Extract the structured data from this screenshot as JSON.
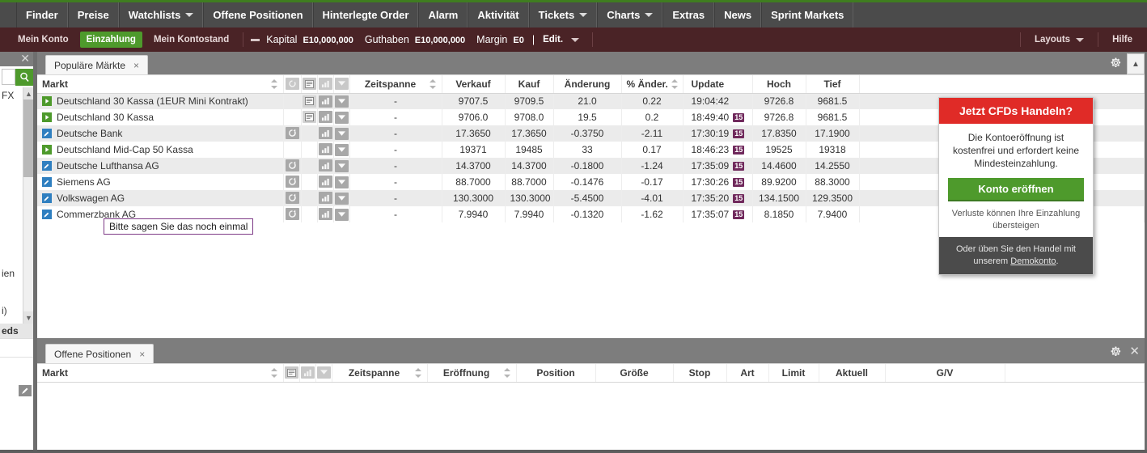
{
  "topnav": {
    "items": [
      {
        "label": "Finder",
        "caret": false
      },
      {
        "label": "Preise",
        "caret": false
      },
      {
        "label": "Watchlists",
        "caret": true
      },
      {
        "label": "Offene Positionen",
        "caret": false
      },
      {
        "label": "Hinterlegte Order",
        "caret": false
      },
      {
        "label": "Alarm",
        "caret": false
      },
      {
        "label": "Aktivität",
        "caret": false
      },
      {
        "label": "Tickets",
        "caret": true
      },
      {
        "label": "Charts",
        "caret": true
      },
      {
        "label": "Extras",
        "caret": false
      },
      {
        "label": "News",
        "caret": false
      },
      {
        "label": "Sprint Markets",
        "caret": false
      }
    ]
  },
  "accountbar": {
    "mein_konto": "Mein Konto",
    "einzahlung": "Einzahlung",
    "mein_kontostand": "Mein Kontostand",
    "kapital_label": "Kapital",
    "kapital_value": "E10,000,000",
    "guthaben_label": "Guthaben",
    "guthaben_value": "E10,000,000",
    "margin_label": "Margin",
    "margin_value": "E0",
    "divider": "|",
    "edit": "Edit.",
    "layouts": "Layouts",
    "hilfe": "Hilfe",
    "accent_green": "#4e9a2c",
    "bar_color": "#4a2326"
  },
  "leftpanel": {
    "close_icon": "close-icon",
    "search_icon": "search-icon",
    "rows": [
      "FX",
      "",
      "",
      "",
      "",
      "ien",
      "",
      "i)",
      ""
    ],
    "footer_row": "eds",
    "scroll_up": "▲",
    "scroll_down": "▼"
  },
  "popular_panel": {
    "tab_label": "Populäre Märkte",
    "tab_close": "×",
    "gear_icon": "gear-icon",
    "close_icon": "close-icon",
    "columns": [
      {
        "key": "markt",
        "label": "Markt",
        "align": "left",
        "sorter": true
      },
      {
        "key": "ico1",
        "label": "",
        "align": "center",
        "sorter": false
      },
      {
        "key": "ico2",
        "label": "",
        "align": "center",
        "sorter": false
      },
      {
        "key": "ico3",
        "label": "",
        "align": "center",
        "sorter": false
      },
      {
        "key": "ico4",
        "label": "",
        "align": "center",
        "sorter": false
      },
      {
        "key": "zeitspanne",
        "label": "Zeitspanne",
        "align": "center",
        "sorter": true
      },
      {
        "key": "verkauf",
        "label": "Verkauf",
        "align": "center",
        "sorter": false
      },
      {
        "key": "kauf",
        "label": "Kauf",
        "align": "center",
        "sorter": false
      },
      {
        "key": "aenderung",
        "label": "Änderung",
        "align": "center",
        "sorter": false
      },
      {
        "key": "pct",
        "label": "% Änder.",
        "align": "center",
        "sorter": true
      },
      {
        "key": "update",
        "label": "Update",
        "align": "center",
        "sorter": false
      },
      {
        "key": "hoch",
        "label": "Hoch",
        "align": "center",
        "sorter": false
      },
      {
        "key": "tief",
        "label": "Tief",
        "align": "center",
        "sorter": false
      },
      {
        "key": "blank",
        "label": "",
        "align": "center",
        "sorter": false
      }
    ],
    "header_icons": [
      "sort-icon",
      "refresh-icon",
      "news-icon",
      "chart-icon",
      "chevron-down-icon"
    ],
    "rows": [
      {
        "markt": "Deutschland 30 Kassa (1EUR Mini Kontrakt)",
        "marker": "green",
        "has_refresh": false,
        "has_news": true,
        "zeitspanne": "-",
        "verkauf": "9707.5",
        "kauf": "9709.5",
        "aenderung": "21.0",
        "aenderung_dir": "up",
        "pct": "0.22",
        "pct_dir": "up",
        "update": "19:04:42",
        "delay": "",
        "hoch": "9726.8",
        "tief": "9681.5"
      },
      {
        "markt": "Deutschland 30 Kassa",
        "marker": "green",
        "has_refresh": false,
        "has_news": true,
        "zeitspanne": "-",
        "verkauf": "9706.0",
        "kauf": "9708.0",
        "aenderung": "19.5",
        "aenderung_dir": "up",
        "pct": "0.2",
        "pct_dir": "up",
        "update": "18:49:40",
        "delay": "15",
        "hoch": "9726.8",
        "tief": "9681.5"
      },
      {
        "markt": "Deutsche Bank",
        "marker": "blue",
        "has_refresh": true,
        "has_news": false,
        "zeitspanne": "-",
        "verkauf": "17.3650",
        "kauf": "17.3650",
        "aenderung": "-0.3750",
        "aenderung_dir": "down",
        "pct": "-2.11",
        "pct_dir": "down",
        "update": "17:30:19",
        "delay": "15",
        "hoch": "17.8350",
        "tief": "17.1900"
      },
      {
        "markt": "Deutschland Mid-Cap 50 Kassa",
        "marker": "green",
        "has_refresh": false,
        "has_news": false,
        "zeitspanne": "-",
        "verkauf": "19371",
        "kauf": "19485",
        "aenderung": "33",
        "aenderung_dir": "up",
        "pct": "0.17",
        "pct_dir": "up",
        "update": "18:46:23",
        "delay": "15",
        "hoch": "19525",
        "tief": "19318"
      },
      {
        "markt": "Deutsche Lufthansa AG",
        "marker": "blue",
        "has_refresh": true,
        "has_news": false,
        "zeitspanne": "-",
        "verkauf": "14.3700",
        "kauf": "14.3700",
        "aenderung": "-0.1800",
        "aenderung_dir": "down",
        "pct": "-1.24",
        "pct_dir": "down",
        "update": "17:35:09",
        "delay": "15",
        "hoch": "14.4600",
        "tief": "14.2550"
      },
      {
        "markt": "Siemens AG",
        "marker": "blue",
        "has_refresh": true,
        "has_news": false,
        "zeitspanne": "-",
        "verkauf": "88.7000",
        "kauf": "88.7000",
        "aenderung": "-0.1476",
        "aenderung_dir": "down",
        "pct": "-0.17",
        "pct_dir": "down",
        "update": "17:30:26",
        "delay": "15",
        "hoch": "89.9200",
        "tief": "88.3000"
      },
      {
        "markt": "Volkswagen AG",
        "marker": "blue",
        "has_refresh": true,
        "has_news": false,
        "zeitspanne": "-",
        "verkauf": "130.3000",
        "kauf": "130.3000",
        "aenderung": "-5.4500",
        "aenderung_dir": "down",
        "pct": "-4.01",
        "pct_dir": "down",
        "update": "17:35:20",
        "delay": "15",
        "hoch": "134.1500",
        "tief": "129.3500"
      },
      {
        "markt": "Commerzbank AG",
        "marker": "blue",
        "has_refresh": true,
        "has_news": false,
        "zeitspanne": "-",
        "verkauf": "7.9940",
        "kauf": "7.9940",
        "aenderung": "-0.1320",
        "aenderung_dir": "down",
        "pct": "-1.62",
        "pct_dir": "down",
        "update": "17:35:07",
        "delay": "15",
        "hoch": "8.1850",
        "tief": "7.9400"
      }
    ]
  },
  "tooltip": {
    "text": "Bitte sagen Sie das noch einmal",
    "border_color": "#7d3a86"
  },
  "promo": {
    "heading": "Jetzt CFDs Handeln?",
    "body": "Die Kontoeröffnung ist kostenfrei und erfordert keine Mindesteinzahlung.",
    "cta": "Konto eröffnen",
    "disclaimer": "Verluste können Ihre Einzahlung übersteigen",
    "footer_pre": "Oder üben Sie den Handel mit unserem ",
    "footer_link": "Demokonto",
    "footer_post": ".",
    "heading_color": "#e02b27",
    "cta_color": "#4e9a2c"
  },
  "positions_panel": {
    "tab_label": "Offene Positionen",
    "tab_close": "×",
    "gear_icon": "gear-icon",
    "close_icon": "close-icon",
    "columns": [
      {
        "key": "markt",
        "label": "Markt",
        "align": "left",
        "sorter": true
      },
      {
        "key": "ico1",
        "label": "",
        "align": "center",
        "sorter": false
      },
      {
        "key": "ico2",
        "label": "",
        "align": "center",
        "sorter": false
      },
      {
        "key": "ico3",
        "label": "",
        "align": "center",
        "sorter": false
      },
      {
        "key": "zeitspanne",
        "label": "Zeitspanne",
        "align": "center",
        "sorter": true
      },
      {
        "key": "eroeffnung",
        "label": "Eröffnung",
        "align": "center",
        "sorter": true
      },
      {
        "key": "position",
        "label": "Position",
        "align": "center",
        "sorter": false
      },
      {
        "key": "groesse",
        "label": "Größe",
        "align": "center",
        "sorter": false
      },
      {
        "key": "stop",
        "label": "Stop",
        "align": "center",
        "sorter": false
      },
      {
        "key": "art",
        "label": "Art",
        "align": "center",
        "sorter": false
      },
      {
        "key": "limit",
        "label": "Limit",
        "align": "center",
        "sorter": false
      },
      {
        "key": "aktuell",
        "label": "Aktuell",
        "align": "center",
        "sorter": false
      },
      {
        "key": "gv",
        "label": "G/V",
        "align": "center",
        "sorter": false
      },
      {
        "key": "blank",
        "label": "",
        "align": "center",
        "sorter": false
      }
    ],
    "rows": []
  }
}
